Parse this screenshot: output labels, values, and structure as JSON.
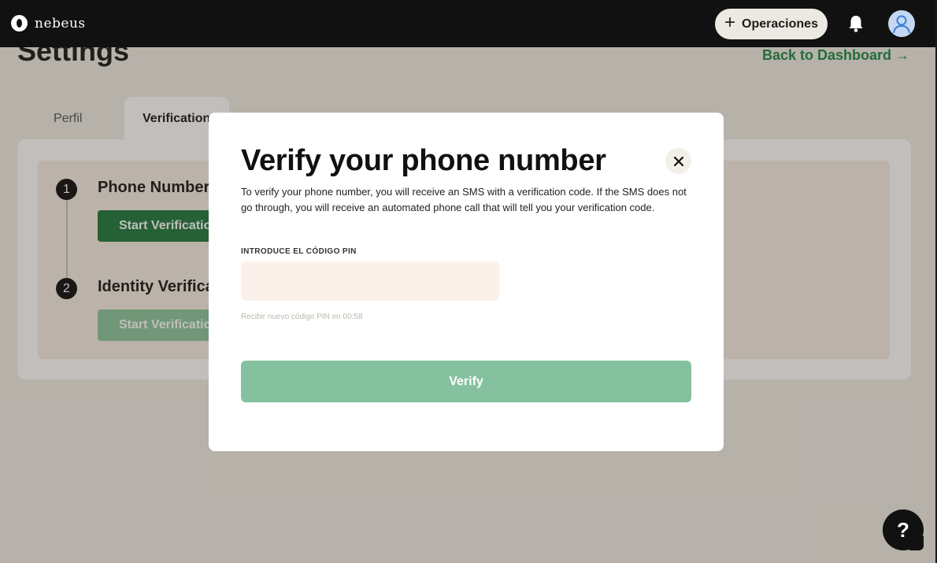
{
  "app": {
    "logo_text": "nebeus"
  },
  "topbar": {
    "operations_label": "Operaciones",
    "plus_icon": "+"
  },
  "page": {
    "title": "Settings",
    "back_link": "Back to Dashboard →"
  },
  "tabs": [
    {
      "label": "Perfil",
      "active": false
    },
    {
      "label": "Verification",
      "active": true
    }
  ],
  "steps": [
    {
      "number": "1",
      "title": "Phone Number Verification",
      "button_label": "Start Verification",
      "button_color": "#227a3f"
    },
    {
      "number": "2",
      "title": "Identity Verification",
      "button_label": "Start Verification",
      "button_color": "#8cc7a0"
    }
  ],
  "modal": {
    "title": "Verify your phone number",
    "description": "To verify your phone number, you will receive an SMS with a verification code. If the SMS does not go through, you will receive an automated phone call that will tell you your verification code.",
    "pin_label": "INTRODUCE EL CÓDIGO PIN",
    "pin_value": "",
    "resend_text": "Recibir nuevo código PIN en 00:58",
    "verify_label": "Verify",
    "close_icon": "close-icon"
  },
  "help": {
    "label": "?"
  },
  "colors": {
    "accent_green": "#1f8a49",
    "verify_button": "#86c19f",
    "topbar": "#111111",
    "background": "#efece6"
  }
}
